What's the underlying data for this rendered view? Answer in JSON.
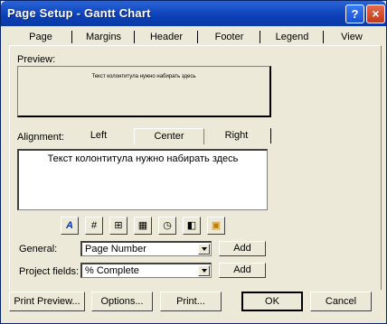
{
  "window": {
    "title": "Page Setup - Gantt Chart",
    "help_label": "?",
    "close_label": "×"
  },
  "tabs": [
    {
      "label": "Page"
    },
    {
      "label": "Margins"
    },
    {
      "label": "Header"
    },
    {
      "label": "Footer"
    },
    {
      "label": "Legend"
    },
    {
      "label": "View"
    }
  ],
  "preview": {
    "label": "Preview:",
    "text": "Текст колонтитула нужно набирать здесь"
  },
  "alignment": {
    "label": "Alignment:",
    "tabs": [
      {
        "label": "Left"
      },
      {
        "label": "Center"
      },
      {
        "label": "Right"
      }
    ],
    "active": "Center"
  },
  "editor": {
    "text": "Текст колонтитула нужно набирать здесь"
  },
  "toolbar": {
    "icons": [
      {
        "name": "format-text-icon",
        "glyph": "A"
      },
      {
        "name": "insert-page-number-icon",
        "glyph": "#"
      },
      {
        "name": "insert-total-pages-icon",
        "glyph": "⊞"
      },
      {
        "name": "insert-date-icon",
        "glyph": "▦"
      },
      {
        "name": "insert-time-icon",
        "glyph": "◷"
      },
      {
        "name": "insert-file-name-icon",
        "glyph": "◧"
      },
      {
        "name": "insert-picture-icon",
        "glyph": "▣"
      }
    ]
  },
  "general": {
    "label": "General:",
    "value": "Page Number",
    "add_label": "Add"
  },
  "project_fields": {
    "label": "Project fields:",
    "value": "% Complete",
    "add_label": "Add"
  },
  "buttons": {
    "print_preview": "Print Preview...",
    "options": "Options...",
    "print": "Print...",
    "ok": "OK",
    "cancel": "Cancel"
  }
}
